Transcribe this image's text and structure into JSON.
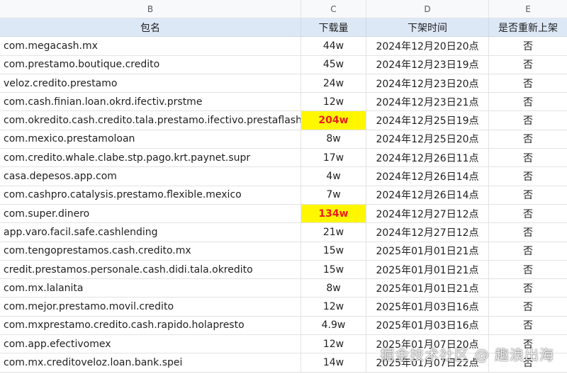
{
  "columns": [
    "B",
    "C",
    "D",
    "E"
  ],
  "header": {
    "package": "包名",
    "downloads": "下载量",
    "removal_time": "下架时间",
    "relisted": "是否重新上架"
  },
  "rows": [
    {
      "package": "com.megacash.mx",
      "downloads": "44w",
      "removal_time": "2024年12月20日20点",
      "relisted": "否",
      "highlight": false
    },
    {
      "package": "com.prestamo.boutique.credito",
      "downloads": "45w",
      "removal_time": "2024年12月23日19点",
      "relisted": "否",
      "highlight": false
    },
    {
      "package": "veloz.credito.prestamo",
      "downloads": "24w",
      "removal_time": "2024年12月23日20点",
      "relisted": "否",
      "highlight": false
    },
    {
      "package": "com.cash.finian.loan.okrd.ifectiv.prstme",
      "downloads": "12w",
      "removal_time": "2024年12月23日21点",
      "relisted": "否",
      "highlight": false
    },
    {
      "package": "com.okredito.cash.credito.tala.prestamo.ifectivo.prestaflash",
      "downloads": "204w",
      "removal_time": "2024年12月25日19点",
      "relisted": "否",
      "highlight": true
    },
    {
      "package": "com.mexico.prestamoloan",
      "downloads": "8w",
      "removal_time": "2024年12月25日20点",
      "relisted": "否",
      "highlight": false
    },
    {
      "package": "com.credito.whale.clabe.stp.pago.krt.paynet.supr",
      "downloads": "17w",
      "removal_time": "2024年12月26日11点",
      "relisted": "否",
      "highlight": false
    },
    {
      "package": "casa.depesos.app.com",
      "downloads": "4w",
      "removal_time": "2024年12月26日14点",
      "relisted": "否",
      "highlight": false
    },
    {
      "package": "com.cashpro.catalysis.prestamo.flexible.mexico",
      "downloads": "7w",
      "removal_time": "2024年12月26日14点",
      "relisted": "否",
      "highlight": false
    },
    {
      "package": "com.super.dinero",
      "downloads": "134w",
      "removal_time": "2024年12月27日12点",
      "relisted": "否",
      "highlight": true
    },
    {
      "package": "app.varo.facil.safe.cashlending",
      "downloads": "21w",
      "removal_time": "2024年12月27日12点",
      "relisted": "否",
      "highlight": false
    },
    {
      "package": "com.tengoprestamos.cash.credito.mx",
      "downloads": "15w",
      "removal_time": "2025年01月01日21点",
      "relisted": "否",
      "highlight": false
    },
    {
      "package": "credit.prestamos.personale.cash.didi.tala.okredito",
      "downloads": "15w",
      "removal_time": "2025年01月01日21点",
      "relisted": "否",
      "highlight": false
    },
    {
      "package": "com.mx.lalanita",
      "downloads": "8w",
      "removal_time": "2025年01月01日21点",
      "relisted": "否",
      "highlight": false
    },
    {
      "package": "com.mejor.prestamo.movil.credito",
      "downloads": "12w",
      "removal_time": "2025年01月03日16点",
      "relisted": "否",
      "highlight": false
    },
    {
      "package": "com.mxprestamo.credito.cash.rapido.holapresto",
      "downloads": "4.9w",
      "removal_time": "2025年01月03日16点",
      "relisted": "否",
      "highlight": false
    },
    {
      "package": "com.app.efectivomex",
      "downloads": "12w",
      "removal_time": "2025年01月07日20点",
      "relisted": "否",
      "highlight": false
    },
    {
      "package": "com.mx.creditoveloz.loan.bank.spei",
      "downloads": "14w",
      "removal_time": "2025年01月07日22点",
      "relisted": "否",
      "highlight": false
    }
  ],
  "watermark": "掘金技术社区 @ 趣浪出海",
  "colors": {
    "highlight_bg": "#fff700",
    "highlight_text": "#ea1e1e",
    "header_bg": "#dde8f7"
  }
}
